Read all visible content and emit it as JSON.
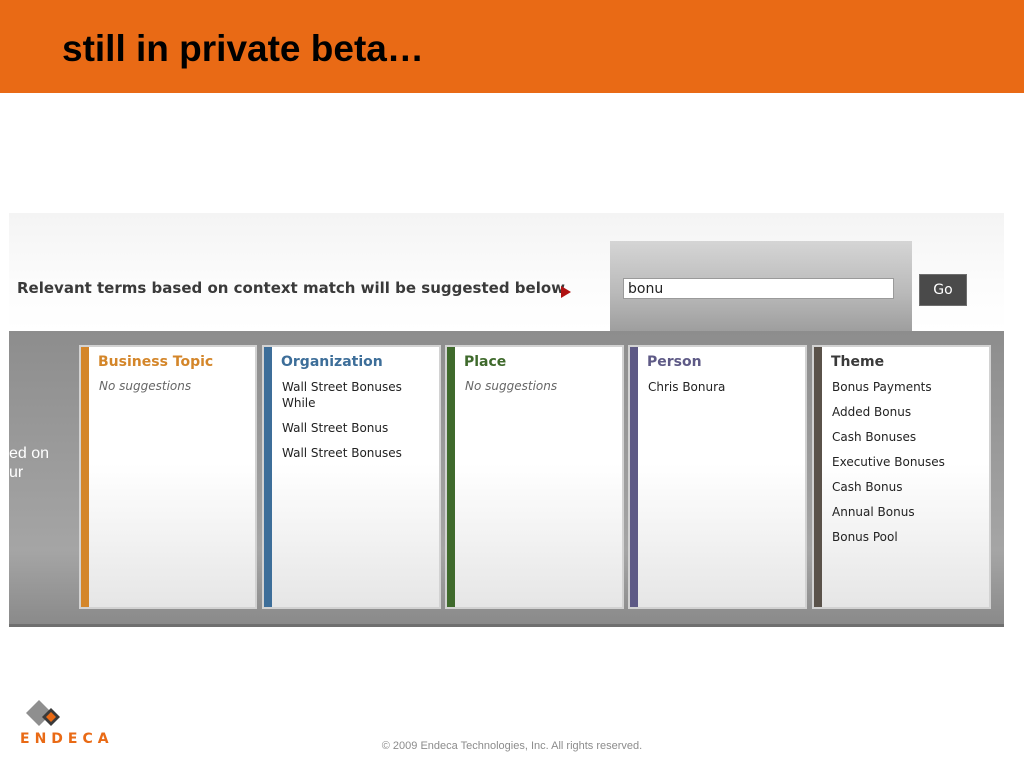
{
  "slide": {
    "title": "still in private beta…",
    "footer": "© 2009 Endeca Technologies, Inc. All rights reserved.",
    "logo_text": "ENDECA"
  },
  "colors": {
    "header_orange": "#e96a15",
    "business_topic": "#d4862a",
    "organization": "#3d6e99",
    "place": "#3f6a2c",
    "person": "#5e5a86",
    "theme": "#5a524a",
    "arrow_red": "#b01212"
  },
  "search": {
    "hint": "Relevant terms based on context match will be suggested below",
    "input_value": "bonu",
    "go_label": "Go"
  },
  "left_fragment": {
    "line1": "ed on",
    "line2": "ur"
  },
  "panels": [
    {
      "title": "Business Topic",
      "items": [],
      "empty_text": "No suggestions"
    },
    {
      "title": "Organization",
      "items": [
        "Wall Street Bonuses While",
        "Wall Street Bonus",
        "Wall Street Bonuses"
      ]
    },
    {
      "title": "Place",
      "items": [],
      "empty_text": "No suggestions"
    },
    {
      "title": "Person",
      "items": [
        "Chris Bonura"
      ]
    },
    {
      "title": "Theme",
      "items": [
        "Bonus Payments",
        "Added Bonus",
        "Cash Bonuses",
        "Executive Bonuses",
        "Cash Bonus",
        "Annual Bonus",
        "Bonus Pool"
      ]
    }
  ]
}
